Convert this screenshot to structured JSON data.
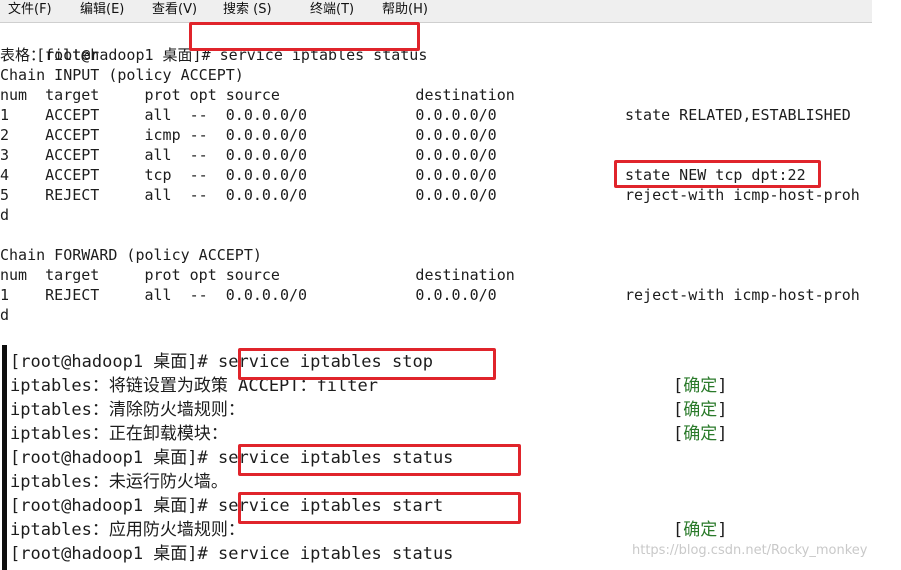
{
  "menu": [
    "文件(F)",
    "编辑(E)",
    "查看(V)",
    "搜索 (S)",
    "终端(T)",
    "帮助(H)"
  ],
  "terminal_top": {
    "prompt": "[root@hadoop1 桌面]#",
    "command": "service iptables status",
    "table_line": "表格：filter",
    "chain_input": "Chain INPUT (policy ACCEPT)",
    "header": "num  target     prot opt source               destination",
    "rows": [
      {
        "line": "1    ACCEPT     all  --  0.0.0.0/0            0.0.0.0/0",
        "extra": "state RELATED,ESTABLISHED"
      },
      {
        "line": "2    ACCEPT     icmp --  0.0.0.0/0            0.0.0.0/0",
        "extra": ""
      },
      {
        "line": "3    ACCEPT     all  --  0.0.0.0/0            0.0.0.0/0",
        "extra": ""
      },
      {
        "line": "4    ACCEPT     tcp  --  0.0.0.0/0            0.0.0.0/0",
        "extra": "state NEW tcp dpt:22"
      },
      {
        "line": "5    REJECT     all  --  0.0.0.0/0            0.0.0.0/0",
        "extra": "reject-with icmp-host-proh"
      }
    ],
    "wrap1": "d",
    "chain_forward": "Chain FORWARD (policy ACCEPT)",
    "header2": "num  target     prot opt source               destination",
    "forward_row": {
      "line": "1    REJECT     all  --  0.0.0.0/0            0.0.0.0/0",
      "extra": "reject-with icmp-host-proh"
    },
    "wrap2": "d"
  },
  "terminal_bottom": {
    "lines": [
      {
        "prompt": "[root@hadoop1 桌面]#",
        "command": "service iptables stop"
      },
      {
        "text": "iptables：将链设置为政策 ACCEPT：filter",
        "status": "确定"
      },
      {
        "text": "iptables：清除防火墙规则：",
        "status": "确定"
      },
      {
        "text": "iptables：正在卸载模块：",
        "status": "确定"
      },
      {
        "prompt": "[root@hadoop1 桌面]#",
        "command": "service iptables status"
      },
      {
        "text": "iptables：未运行防火墙。"
      },
      {
        "prompt": "[root@hadoop1 桌面]#",
        "command": "service iptables start"
      },
      {
        "text": "iptables：应用防火墙规则：",
        "status": "确定"
      },
      {
        "prompt": "[root@hadoop1 桌面]#",
        "command": "service iptables status"
      }
    ]
  },
  "watermark": "https://blog.csdn.net/Rocky_monkey",
  "colors": {
    "highlight": "#e0242b",
    "ok_text": "#2a7a2a",
    "terminal_bg": "#ffffff"
  }
}
